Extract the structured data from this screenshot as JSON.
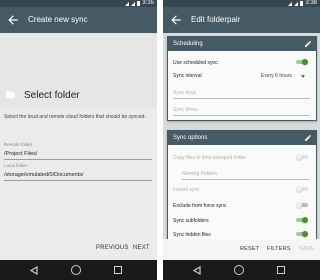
{
  "colors": {
    "appbar": "#455a64",
    "statusbar": "#37474f",
    "accent": "#558b2f"
  },
  "left": {
    "status_time": "3:35",
    "title": "Create new sync",
    "heading": "Select folder",
    "description": "Select the local and remote cloud folders that should be synced.",
    "remote_label": "Remote folder",
    "remote_value": "/Project Files/",
    "local_label": "Local folder",
    "local_value": "/storage/emulated/0/Documents/",
    "previous_label": "PREVIOUS",
    "next_label": "NEXT"
  },
  "right": {
    "status_time": "3:38",
    "title": "Edit folderpair",
    "scheduling": {
      "header": "Scheduling",
      "use_scheduled": {
        "label": "Use scheduled sync",
        "on": true
      },
      "interval_label": "Sync interval",
      "interval_value": "Every 6 hours",
      "days_placeholder": "Sync days",
      "times_placeholder": "Sync times"
    },
    "options": {
      "header": "Sync options",
      "items": [
        {
          "label": "Copy files to time-stamped folder",
          "state": "disabled"
        },
        {
          "label": "Naming Pattern",
          "state": "disabled"
        },
        {
          "label": "Instant sync",
          "state": "disabled"
        },
        {
          "label": "Exclude from force sync",
          "state": "off"
        },
        {
          "label": "Sync subfolders",
          "state": "on"
        },
        {
          "label": "Sync hidden files",
          "state": "on"
        }
      ]
    },
    "reset_label": "RESET",
    "filters_label": "FILTERS",
    "save_label": "SAVE"
  }
}
